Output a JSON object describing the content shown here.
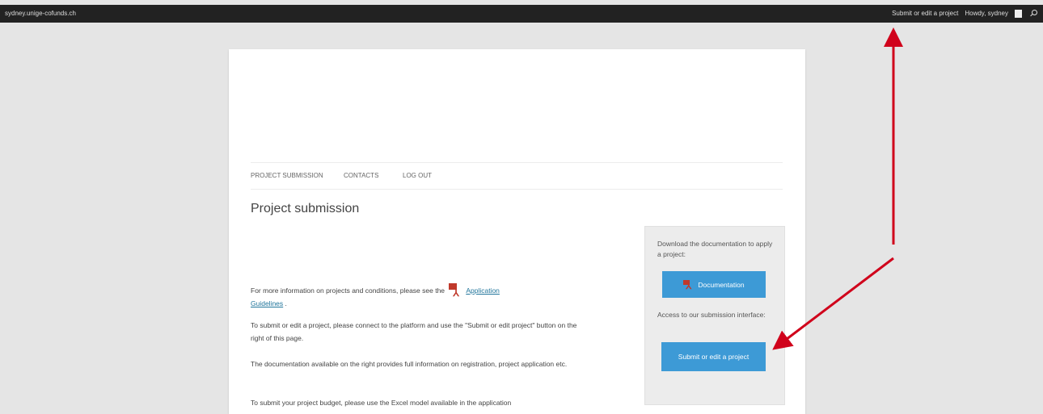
{
  "adminbar": {
    "site": "sydney.unige-cofunds.ch",
    "submit": "Submit or edit a project",
    "howdy": "Howdy, sydney"
  },
  "nav": {
    "items": [
      "PROJECT SUBMISSION",
      "CONTACTS",
      "LOG OUT"
    ]
  },
  "page": {
    "title": "Project submission",
    "para1_prefix": "For more information on projects and conditions, please see the",
    "para1_link_a": "Application",
    "para1_link_b": "Guidelines",
    "para1_suffix": ".",
    "para2": "To submit or edit a project, please connect to the platform and use the \"Submit or edit project\" button on the right of this page.",
    "para3": "The documentation available on the right provides full information on registration, project application etc.",
    "para4": "To submit your project budget, please use the Excel model available in the application"
  },
  "sidebar": {
    "download_text": "Download the documentation to apply a project:",
    "doc_button": "Documentation",
    "access_text": "Access to our submission interface:",
    "submit_button": "Submit or edit a project"
  },
  "colors": {
    "adminbar": "#222222",
    "button": "#3d9ad6",
    "arrow": "#d0021b",
    "link": "#21759b"
  }
}
